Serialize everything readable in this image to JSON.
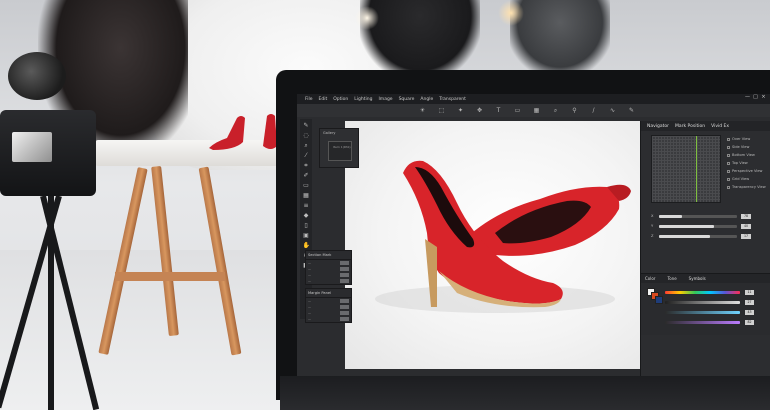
{
  "menu": {
    "items": [
      "File",
      "Edit",
      "Option",
      "Lighting",
      "Image",
      "Square",
      "Angle",
      "Transparent"
    ]
  },
  "window": {
    "controls": [
      "—",
      "□",
      "×"
    ]
  },
  "toolbar": {
    "icons": [
      "sun-icon",
      "dashed-rect-icon",
      "sparkle-icon",
      "move-icon",
      "text-icon",
      "chat-icon",
      "grid-icon",
      "search-icon",
      "pin-icon",
      "needle-icon",
      "curve-icon",
      "brush-icon"
    ]
  },
  "mini_panel": {
    "title": "Gallery",
    "box_label": "Item 1(PAS)"
  },
  "section_mark_panel": {
    "title": "Section Mark",
    "rows": [
      "—",
      "—",
      "—",
      "—"
    ]
  },
  "margin_panel": {
    "title": "Margin Panel",
    "rows": [
      "—",
      "—",
      "—",
      "—"
    ]
  },
  "navigator": {
    "tabs": [
      "Navigator",
      "Mark Position",
      "Vivid Ex"
    ],
    "views": [
      "Over View",
      "Side View",
      "Bottom View",
      "Top View",
      "Perspective View",
      "Grid View",
      "Transparency View"
    ]
  },
  "sliders": [
    {
      "label": "X",
      "value": "78",
      "level": 0.3
    },
    {
      "label": "Y",
      "value": "40",
      "level": 0.7
    },
    {
      "label": "Z",
      "value": "17",
      "level": 0.65
    }
  ],
  "color_panel": {
    "tabs": [
      "Color",
      "Tone",
      "Symbols"
    ],
    "channels": [
      {
        "value": "11",
        "gradient": "linear-gradient(90deg,#ff3b30,#ffcc00,#34c759,#00c7ff,#5856d6,#ff2d55)"
      },
      {
        "value": "27",
        "gradient": "linear-gradient(90deg,#202020,#e0e0e0)"
      },
      {
        "value": "43",
        "gradient": "linear-gradient(90deg,#2b2b2b,#6fd3ff)"
      },
      {
        "value": "82",
        "gradient": "linear-gradient(90deg,#2b2b2b,#bb7cff)"
      }
    ]
  },
  "colors": {
    "shoe_red": "#d8242a",
    "nav_line": "#7fbf3f"
  }
}
